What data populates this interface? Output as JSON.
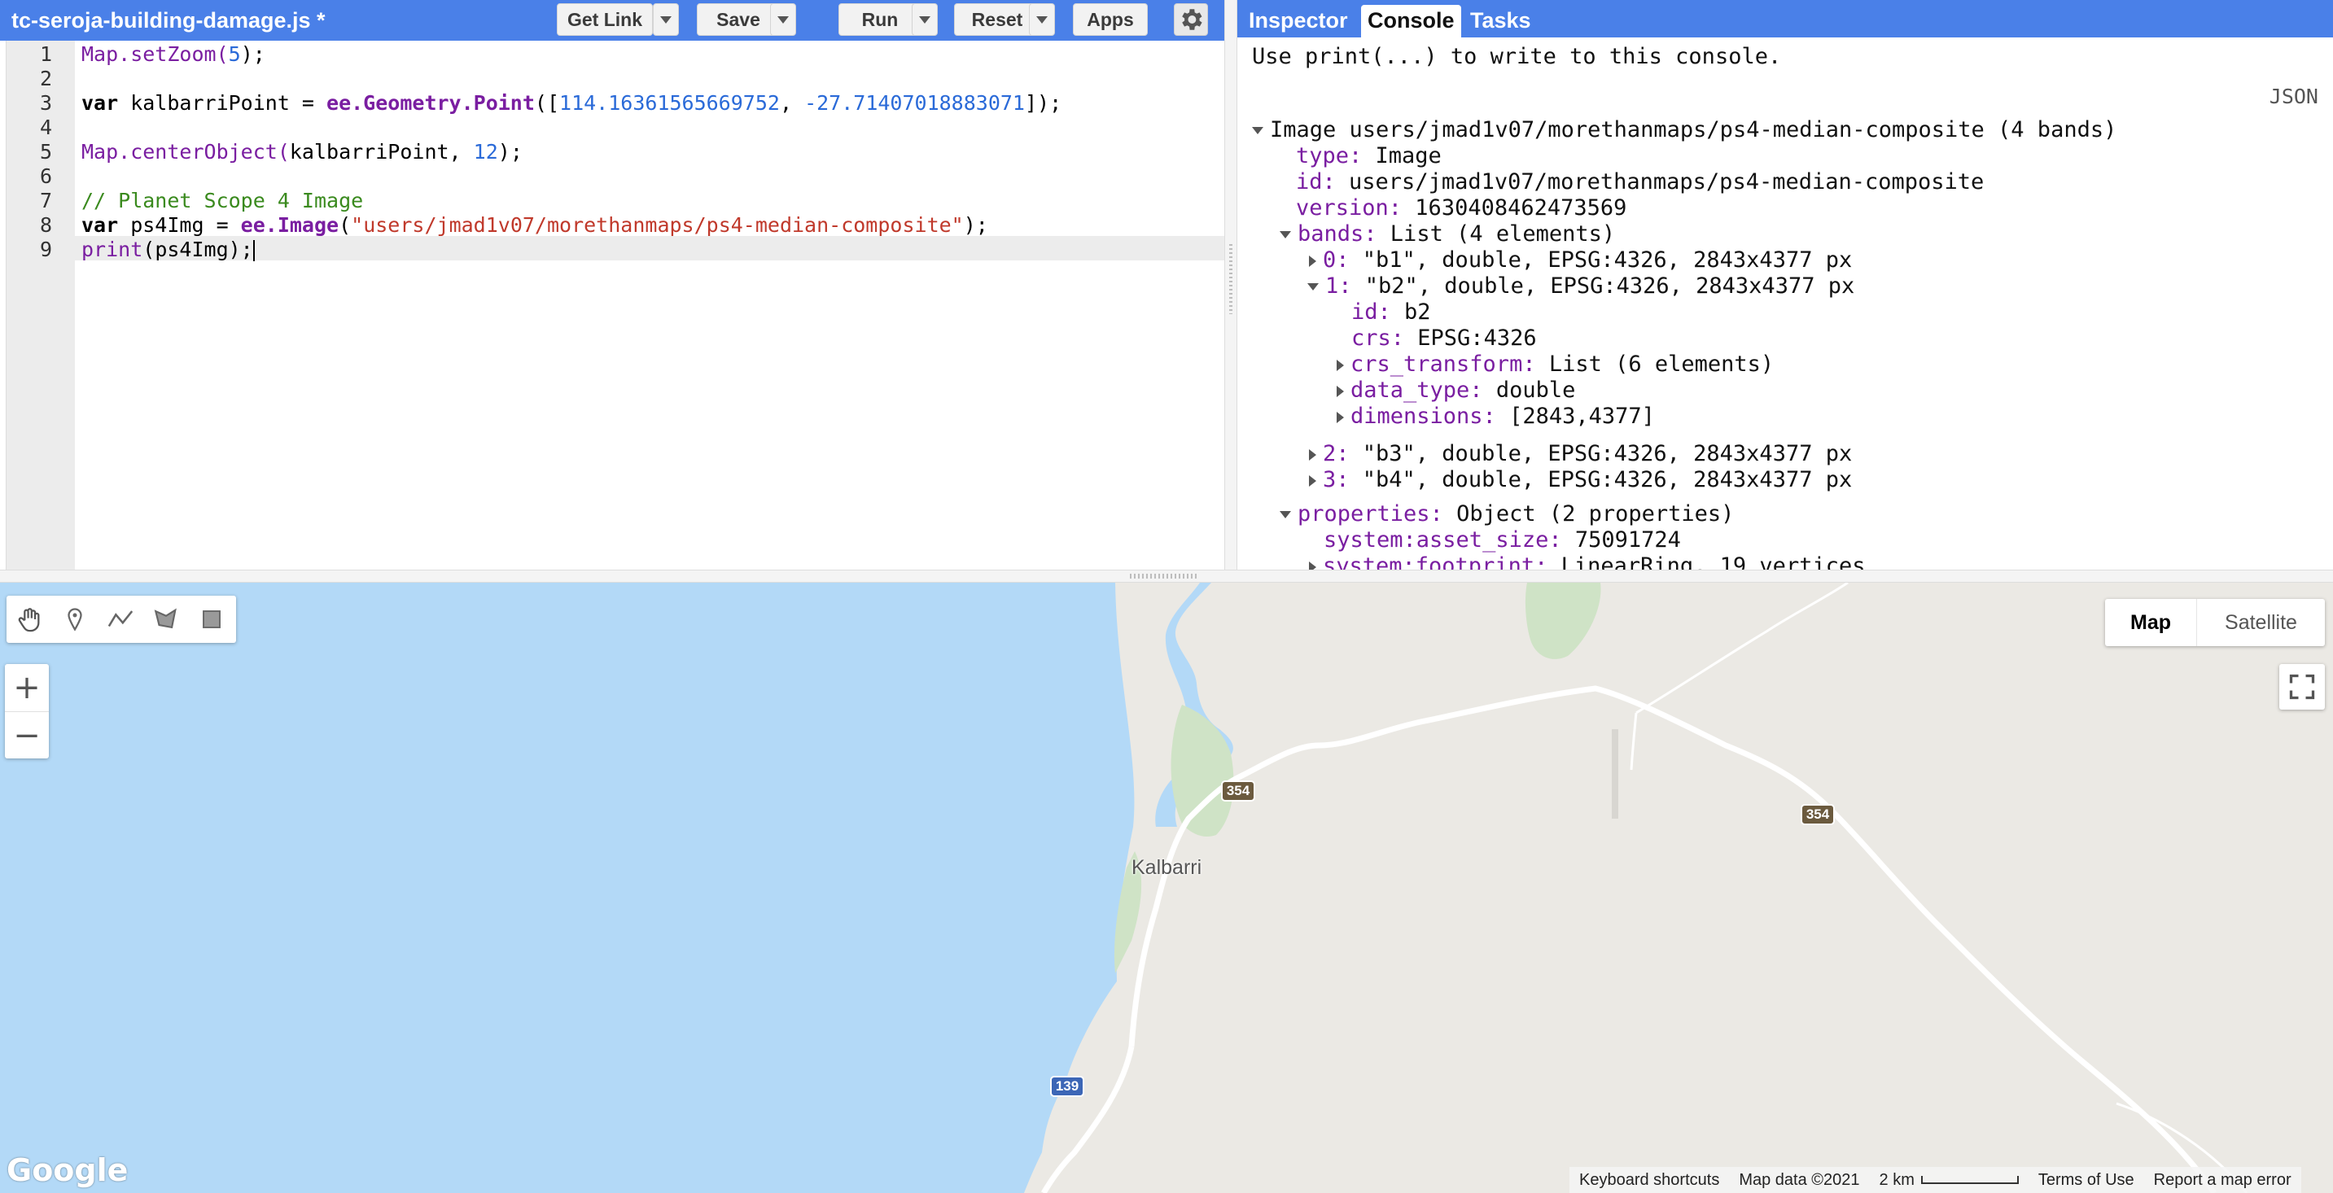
{
  "editor": {
    "file_title": "tc-seroja-building-damage.js *",
    "toolbar": {
      "get_link": "Get Link",
      "save": "Save",
      "run": "Run",
      "reset": "Reset",
      "apps": "Apps"
    },
    "lines": [
      {
        "n": "1"
      },
      {
        "n": "2"
      },
      {
        "n": "3"
      },
      {
        "n": "4"
      },
      {
        "n": "5"
      },
      {
        "n": "6"
      },
      {
        "n": "7"
      },
      {
        "n": "8"
      },
      {
        "n": "9"
      }
    ],
    "code": {
      "l1_fn": "Map.setZoom(",
      "l1_num": "5",
      "l1_end": ");",
      "l3_kw": "var",
      "l3_name": " kalbarriPoint = ",
      "l3_ee": "ee.Geometry.Point",
      "l3_open": "([",
      "l3_lon": "114.16361565669752",
      "l3_sep": ", ",
      "l3_lat": "-27.71407018883071",
      "l3_end": "]);",
      "l5_fn": "Map.centerObject(",
      "l5_arg": "kalbarriPoint, ",
      "l5_num": "12",
      "l5_end": ");",
      "l7_comment": "// Planet Scope 4 Image",
      "l8_kw": "var",
      "l8_name": " ps4Img = ",
      "l8_ee": "ee.Image",
      "l8_open": "(",
      "l8_str": "\"users/jmad1v07/morethanmaps/ps4-median-composite\"",
      "l8_end": ");",
      "l9_fn": "print",
      "l9_end": "(ps4Img);"
    }
  },
  "panel": {
    "tabs": [
      "Inspector",
      "Console",
      "Tasks"
    ],
    "active_tab": "Console",
    "console_hint": "Use print(...) to write to this console.",
    "json_link": "JSON",
    "image_header": "Image users/jmad1v07/morethanmaps/ps4-median-composite (4 bands)",
    "rows": {
      "type_k": "type:",
      "type_v": " Image",
      "id_k": "id:",
      "id_v": " users/jmad1v07/morethanmaps/ps4-median-composite",
      "version_k": "version:",
      "version_v": " 1630408462473569",
      "bands_k": "bands:",
      "bands_v": " List (4 elements)",
      "b0_k": "0:",
      "b0_v": " \"b1\", double, EPSG:4326, 2843x4377 px",
      "b1_k": "1:",
      "b1_v": " \"b2\", double, EPSG:4326, 2843x4377 px",
      "b1_id_k": "id:",
      "b1_id_v": " b2",
      "b1_crs_k": "crs:",
      "b1_crs_v": " EPSG:4326",
      "b1_ct_k": "crs_transform:",
      "b1_ct_v": " List (6 elements)",
      "b1_dt_k": "data_type:",
      "b1_dt_v": " double",
      "b1_dim_k": "dimensions:",
      "b1_dim_v": " [2843,4377]",
      "b2_k": "2:",
      "b2_v": " \"b3\", double, EPSG:4326, 2843x4377 px",
      "b3_k": "3:",
      "b3_v": " \"b4\", double, EPSG:4326, 2843x4377 px",
      "props_k": "properties:",
      "props_v": " Object (2 properties)",
      "asset_k": "system:asset_size:",
      "asset_v": " 75091724",
      "foot_k": "system:footprint:",
      "foot_v": " LinearRing, 19 vertices"
    }
  },
  "map": {
    "map_type": [
      "Map",
      "Satellite"
    ],
    "active_map_type": "Map",
    "zoom_in": "+",
    "zoom_out": "−",
    "place_label": "Kalbarri",
    "shields": [
      "354",
      "354",
      "139"
    ],
    "google_logo": "Google",
    "attribution": {
      "keyboard": "Keyboard shortcuts",
      "map_data": "Map data ©2021",
      "scale": "2 km",
      "terms": "Terms of Use",
      "report": "Report a map error"
    },
    "colors": {
      "water": "#b3d9f7",
      "land": "#ebe9e4",
      "park": "#cfe3c6",
      "road": "#ffffff",
      "shield_state": "#6b5a3e",
      "shield_hwy": "#3c66b6"
    }
  }
}
